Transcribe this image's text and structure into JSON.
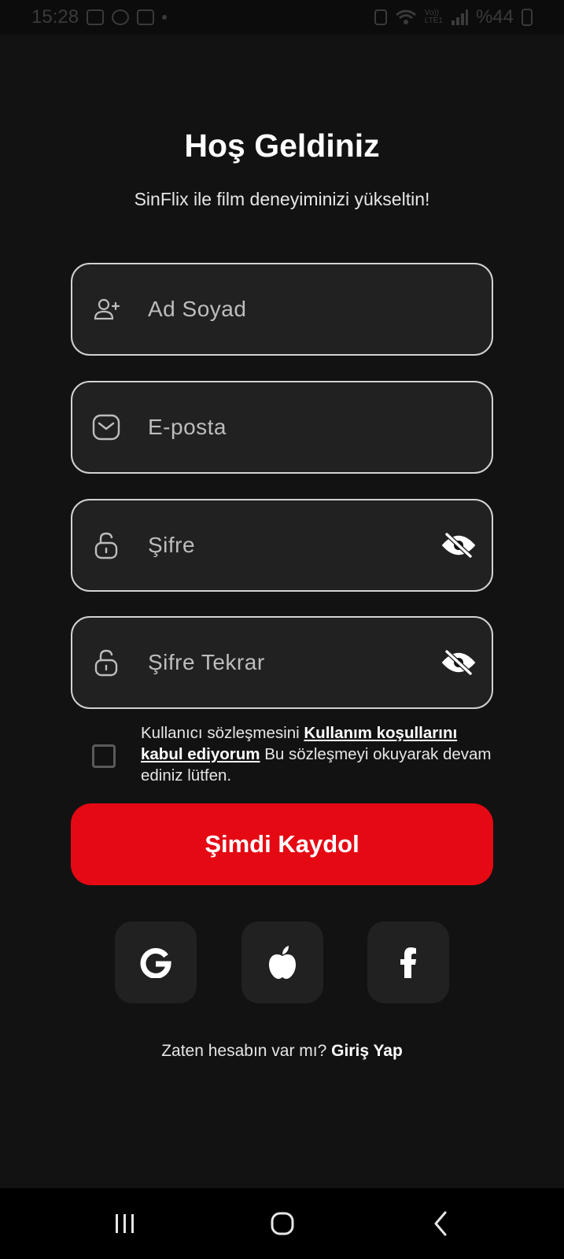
{
  "status_bar": {
    "time": "15:28",
    "network_top": "Vo))",
    "network_bottom": "LTE1",
    "battery": "%44"
  },
  "header": {
    "title": "Hoş Geldiniz",
    "subtitle": "SinFlix ile film deneyiminizi yükseltin!"
  },
  "form": {
    "name_placeholder": "Ad Soyad",
    "email_placeholder": "E-posta",
    "password_placeholder": "Şifre",
    "password_repeat_placeholder": "Şifre Tekrar"
  },
  "terms": {
    "checked": false,
    "prefix": "Kullanıcı sözleşmesini ",
    "link": "Kullanım koşullarını kabul ediyorum",
    "suffix": " Bu sözleşmeyi okuyarak devam ediniz lütfen."
  },
  "register_button": "Şimdi Kaydol",
  "social": [
    "google",
    "apple",
    "facebook"
  ],
  "login_prompt": {
    "question": "Zaten hesabın var mı? ",
    "link": "Giriş Yap"
  },
  "colors": {
    "background": "#121212",
    "field_background": "#212121",
    "accent": "#e50914"
  }
}
